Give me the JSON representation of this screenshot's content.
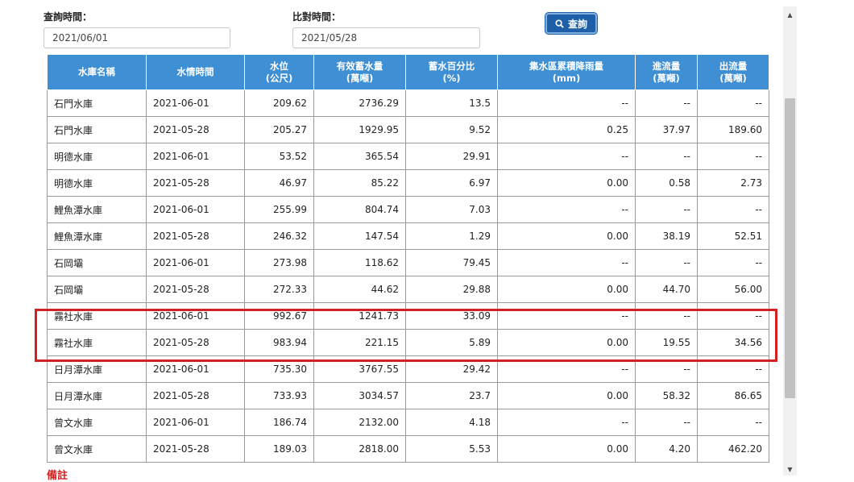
{
  "query": {
    "query_time_label": "查詢時間：",
    "query_time_value": "2021/06/01",
    "compare_time_label": "比對時間：",
    "compare_time_value": "2021/05/28",
    "search_label": "查詢"
  },
  "table": {
    "headers": [
      "水庫名稱",
      "水情時間",
      "水位\n(公尺)",
      "有效蓄水量\n(萬噸)",
      "蓄水百分比\n(%)",
      "集水區累積降雨量\n(mm)",
      "進流量\n(萬噸)",
      "出流量\n(萬噸)"
    ],
    "rows": [
      [
        "石門水庫",
        "2021-06-01",
        "209.62",
        "2736.29",
        "13.5",
        "--",
        "--",
        "--"
      ],
      [
        "石門水庫",
        "2021-05-28",
        "205.27",
        "1929.95",
        "9.52",
        "0.25",
        "37.97",
        "189.60"
      ],
      [
        "明德水庫",
        "2021-06-01",
        "53.52",
        "365.54",
        "29.91",
        "--",
        "--",
        "--"
      ],
      [
        "明德水庫",
        "2021-05-28",
        "46.97",
        "85.22",
        "6.97",
        "0.00",
        "0.58",
        "2.73"
      ],
      [
        "鯉魚潭水庫",
        "2021-06-01",
        "255.99",
        "804.74",
        "7.03",
        "--",
        "--",
        "--"
      ],
      [
        "鯉魚潭水庫",
        "2021-05-28",
        "246.32",
        "147.54",
        "1.29",
        "0.00",
        "38.19",
        "52.51"
      ],
      [
        "石岡壩",
        "2021-06-01",
        "273.98",
        "118.62",
        "79.45",
        "--",
        "--",
        "--"
      ],
      [
        "石岡壩",
        "2021-05-28",
        "272.33",
        "44.62",
        "29.88",
        "0.00",
        "44.70",
        "56.00"
      ],
      [
        "霧社水庫",
        "2021-06-01",
        "992.67",
        "1241.73",
        "33.09",
        "--",
        "--",
        "--"
      ],
      [
        "霧社水庫",
        "2021-05-28",
        "983.94",
        "221.15",
        "5.89",
        "0.00",
        "19.55",
        "34.56"
      ],
      [
        "日月潭水庫",
        "2021-06-01",
        "735.30",
        "3767.55",
        "29.42",
        "--",
        "--",
        "--"
      ],
      [
        "日月潭水庫",
        "2021-05-28",
        "733.93",
        "3034.57",
        "23.7",
        "0.00",
        "58.32",
        "86.65"
      ],
      [
        "曾文水庫",
        "2021-06-01",
        "186.74",
        "2132.00",
        "4.18",
        "--",
        "--",
        "--"
      ],
      [
        "曾文水庫",
        "2021-05-28",
        "189.03",
        "2818.00",
        "5.53",
        "0.00",
        "4.20",
        "462.20"
      ]
    ]
  },
  "footer_note": "備註",
  "colors": {
    "header_bg": "#3f8fd4",
    "button_bg": "#1e5fa8",
    "highlight": "#d42020"
  },
  "icons": {
    "search_button": "search-icon"
  }
}
